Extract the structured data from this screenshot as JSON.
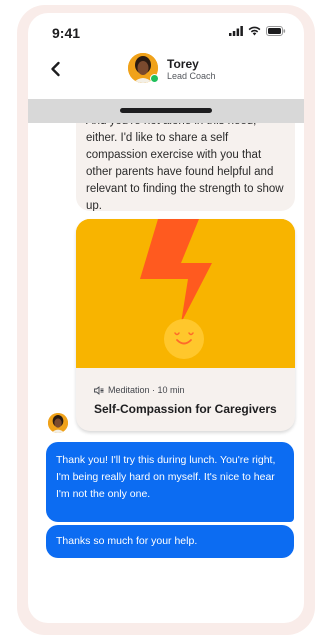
{
  "status": {
    "time": "9:41",
    "icons": [
      "signal-icon",
      "wifi-icon",
      "battery-icon"
    ]
  },
  "header": {
    "back_icon": "back-chevron-icon",
    "name": "Torey",
    "role": "Lead Coach"
  },
  "messages": {
    "incoming_text": "And you're not alone in this need, either. I'd like to share a self compassion exercise with you that other parents have found helpful and relevant to finding the strength to show up.",
    "card": {
      "meta": "Meditation · 10 min",
      "title": "Self-Compassion for Caregivers"
    },
    "outgoing": [
      "Thank you! I'll try this during lunch. You're right, I'm being really hard on myself. It's nice to hear I'm not the only one.",
      "Thanks so much for your help."
    ]
  },
  "colors": {
    "phone_frame": "#f9ece9",
    "outgoing_bubble": "#0c6cf2",
    "card_art_bg": "#f8b400",
    "bolt": "#ff5a1f",
    "online": "#1fbf5b"
  }
}
